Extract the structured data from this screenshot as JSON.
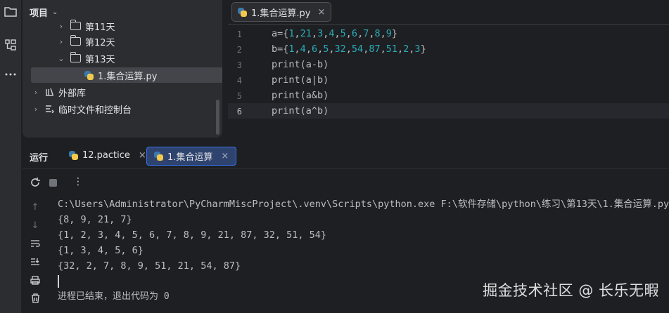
{
  "project_panel": {
    "title": "项目",
    "tree": [
      {
        "label": "第11天",
        "level": 1
      },
      {
        "label": "第12天",
        "level": 1
      },
      {
        "label": "第13天",
        "level": 1
      },
      {
        "label": "1.集合运算.py",
        "level": 2
      },
      {
        "label": "外部库",
        "level": 0
      },
      {
        "label": "临时文件和控制台",
        "level": 0
      }
    ]
  },
  "editor": {
    "tab_label": "1.集合运算.py",
    "line_numbers": [
      "1",
      "2",
      "3",
      "4",
      "5",
      "6"
    ],
    "lines": [
      "a={1,21,3,4,5,6,7,8,9}",
      "b={1,4,6,5,32,54,87,51,2,3}",
      "print(a-b)",
      "print(a|b)",
      "print(a&b)",
      "print(a^b)"
    ]
  },
  "run_panel": {
    "title": "运行",
    "tabs": [
      "12.pactice",
      "1.集合运算"
    ],
    "output": [
      "C:\\Users\\Administrator\\PyCharmMiscProject\\.venv\\Scripts\\python.exe F:\\软件存储\\python\\练习\\第13天\\1.集合运算.py",
      "{8, 9, 21, 7}",
      "{1, 2, 3, 4, 5, 6, 7, 8, 9, 21, 87, 32, 51, 54}",
      "{1, 3, 4, 5, 6}",
      "{32, 2, 7, 8, 9, 51, 21, 54, 87}",
      "",
      "进程已结束，退出代码为 0"
    ]
  },
  "watermark": "掘金技术社区 @ 长乐无暇",
  "colors": {
    "background": "#1e1f22",
    "panel": "#2b2d30",
    "accent": "#3574f0",
    "number": "#2aacb8"
  }
}
